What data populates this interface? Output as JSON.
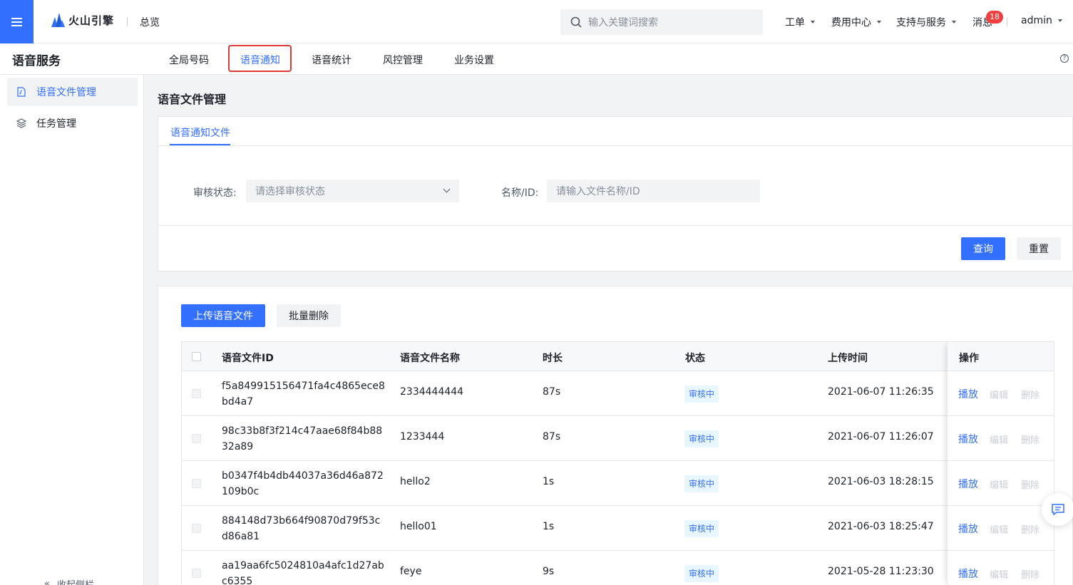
{
  "topbar": {
    "logo_text": "火山引擎",
    "overview": "总览",
    "search_placeholder": "输入关键词搜索",
    "nav": [
      "工单",
      "费用中心",
      "支持与服务"
    ],
    "messages_label": "消息",
    "messages_count": "18",
    "user": "admin"
  },
  "subbar": {
    "service_title": "语音服务",
    "tabs": [
      "全局号码",
      "语音通知",
      "语音统计",
      "风控管理",
      "业务设置"
    ],
    "active_tab": "语音通知",
    "help": "?"
  },
  "sidebar": {
    "items": [
      "语音文件管理",
      "任务管理"
    ],
    "collapse_label": "收起侧栏"
  },
  "main": {
    "page_title": "语音文件管理",
    "tab": "语音通知文件",
    "filter": {
      "status_label": "审核状态:",
      "status_placeholder": "请选择审核状态",
      "name_label": "名称/ID:",
      "name_placeholder": "请输入文件名称/ID"
    },
    "query_button": "查询",
    "reset_button": "重置",
    "upload_button": "上传语音文件",
    "batch_delete_button": "批量删除"
  },
  "table": {
    "columns": [
      "语音文件ID",
      "语音文件名称",
      "时长",
      "状态",
      "上传时间",
      "操作"
    ],
    "rows": [
      {
        "id": "f5a849915156471fa4c4865ece8bd4a7",
        "name": "2334444444",
        "duration": "87s",
        "status": "审核中",
        "time": "2021-06-07 11:26:35"
      },
      {
        "id": "98c33b8f3f214c47aae68f84b8832a89",
        "name": "1233444",
        "duration": "87s",
        "status": "审核中",
        "time": "2021-06-07 11:26:07"
      },
      {
        "id": "b0347f4b4db44037a36d46a872109b0c",
        "name": "hello2",
        "duration": "1s",
        "status": "审核中",
        "time": "2021-06-03 18:28:15"
      },
      {
        "id": "884148d73b664f90870d79f53cd86a81",
        "name": "hello01",
        "duration": "1s",
        "status": "审核中",
        "time": "2021-06-03 18:25:47"
      },
      {
        "id": "aa19aa6fc5024810a4afc1d27abc6355",
        "name": "feye",
        "duration": "9s",
        "status": "审核中",
        "time": "2021-05-28 11:23:30"
      }
    ],
    "actions": {
      "play": "播放",
      "edit": "编辑",
      "delete": "删除"
    }
  }
}
